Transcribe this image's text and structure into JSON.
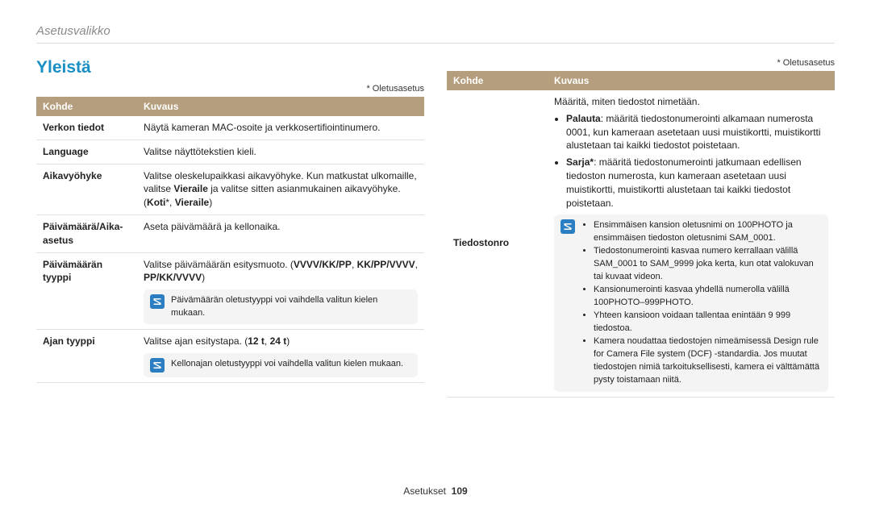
{
  "breadcrumb": "Asetusvalikko",
  "section_title": "Yleistä",
  "default_note": "* Oletusasetus",
  "table_headers": {
    "kohde": "Kohde",
    "kuvaus": "Kuvaus"
  },
  "left_table": [
    {
      "k": "Verkon tiedot",
      "v": "Näytä kameran MAC-osoite ja verkkosertifiointinumero."
    },
    {
      "k": "Language",
      "v": "Valitse näyttötekstien kieli."
    },
    {
      "k": "Aikavyöhyke",
      "v": "Valitse oleskelupaikkasi aikavyöhyke. Kun matkustat ulkomaille, valitse Vieraile ja valitse sitten asianmukainen aikavyöhyke. (Koti*, Vieraile)"
    },
    {
      "k": "Päivämäärä/Aika-asetus",
      "v": "Aseta päivämäärä ja kellonaika."
    },
    {
      "k": "Päivämäärän tyyppi",
      "v": "Valitse päivämäärän esitysmuoto. (VVVV/KK/PP, KK/PP/VVVV, PP/KK/VVVV)",
      "note": "Päivämäärän oletustyyppi voi vaihdella valitun kielen mukaan."
    },
    {
      "k": "Ajan tyyppi",
      "v": "Valitse ajan esitystapa. (12 t, 24 t)",
      "note": "Kellonajan oletustyyppi voi vaihdella valitun kielen mukaan."
    }
  ],
  "right_table": {
    "kohde": "Tiedostonro",
    "intro": "Määritä, miten tiedostot nimetään.",
    "bullets": [
      {
        "label": "Palauta",
        "text": ": määritä tiedostonumerointi alkamaan numerosta 0001, kun kameraan asetetaan uusi muistikortti, muistikortti alustetaan tai kaikki tiedostot poistetaan."
      },
      {
        "label": "Sarja*",
        "text": ": määritä tiedostonumerointi jatkumaan edellisen tiedoston numerosta, kun kameraan asetetaan uusi muistikortti, muistikortti alustetaan tai kaikki tiedostot poistetaan."
      }
    ],
    "notes": [
      "Ensimmäisen kansion oletusnimi on 100PHOTO ja ensimmäisen tiedoston oletusnimi SAM_0001.",
      "Tiedostonumerointi kasvaa numero kerrallaan välillä SAM_0001 to SAM_9999 joka kerta, kun otat valokuvan tai kuvaat videon.",
      "Kansionumerointi kasvaa yhdellä numerolla välillä 100PHOTO–999PHOTO.",
      "Yhteen kansioon voidaan tallentaa enintään 9 999 tiedostoa.",
      "Kamera noudattaa tiedostojen nimeämisessä Design rule for Camera File system (DCF) -standardia. Jos muutat tiedostojen nimiä tarkoituksellisesti, kamera ei välttämättä pysty toistamaan niitä."
    ]
  },
  "footer": {
    "label": "Asetukset",
    "page": "109"
  }
}
